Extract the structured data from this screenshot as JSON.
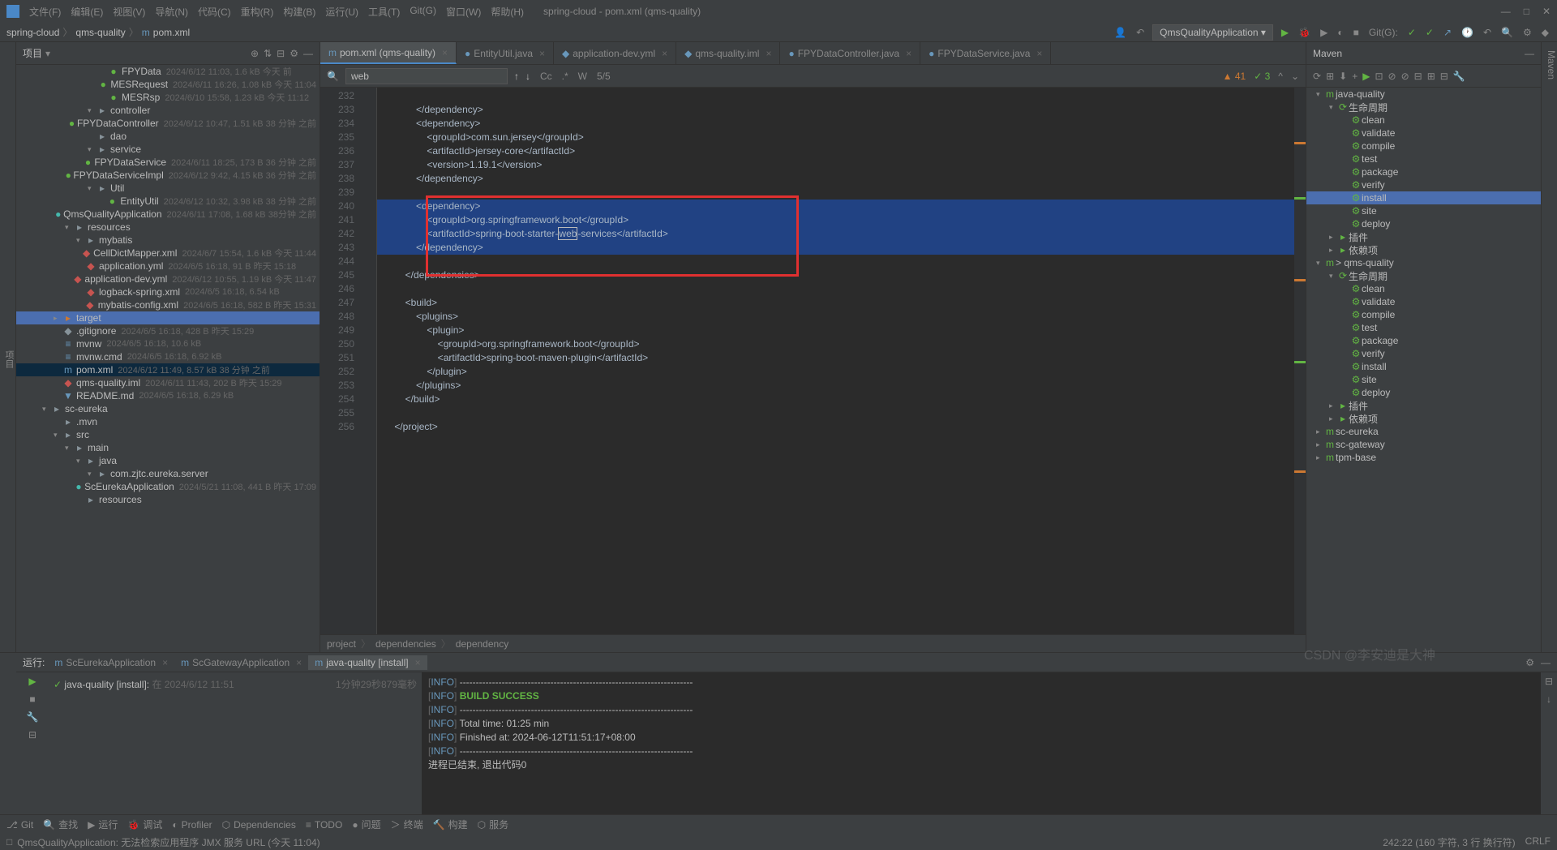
{
  "title": "spring-cloud - pom.xml (qms-quality)",
  "menus": [
    "文件(F)",
    "编辑(E)",
    "视图(V)",
    "导航(N)",
    "代码(C)",
    "重构(R)",
    "构建(B)",
    "运行(U)",
    "工具(T)",
    "Git(G)",
    "窗口(W)",
    "帮助(H)"
  ],
  "breadcrumb": {
    "p1": "spring-cloud",
    "p2": "qms-quality",
    "p3": "pom.xml",
    "icon": "m"
  },
  "topright": {
    "runconfig": "QmsQualityApplication",
    "git": "Git(G):"
  },
  "project": {
    "label": "项目"
  },
  "tree": [
    {
      "d": 7,
      "a": "",
      "i": "green",
      "ico": "●",
      "n": "FPYData",
      "m": "2024/6/12 11:03, 1.6 kB 今天 前"
    },
    {
      "d": 7,
      "a": "",
      "i": "green",
      "ico": "●",
      "n": "MESRequest",
      "m": "2024/6/11 16:26, 1.08 kB 今天 11:04"
    },
    {
      "d": 7,
      "a": "",
      "i": "green",
      "ico": "●",
      "n": "MESRsp",
      "m": "2024/6/10 15:58, 1.23 kB 今天 11:12"
    },
    {
      "d": 6,
      "a": "▾",
      "i": "folder",
      "ico": "▸",
      "n": "controller",
      "m": ""
    },
    {
      "d": 7,
      "a": "",
      "i": "green",
      "ico": "●",
      "n": "FPYDataController",
      "m": "2024/6/12 10:47, 1.51 kB 38 分钟 之前"
    },
    {
      "d": 6,
      "a": "",
      "i": "folder",
      "ico": "▸",
      "n": "dao",
      "m": ""
    },
    {
      "d": 6,
      "a": "▾",
      "i": "folder",
      "ico": "▸",
      "n": "service",
      "m": ""
    },
    {
      "d": 7,
      "a": "",
      "i": "green",
      "ico": "●",
      "n": "FPYDataService",
      "m": "2024/6/11 18:25, 173 B 36 分钟 之前"
    },
    {
      "d": 7,
      "a": "",
      "i": "green",
      "ico": "●",
      "n": "FPYDataServiceImpl",
      "m": "2024/6/12 9:42, 4.15 kB 36 分钟 之前"
    },
    {
      "d": 6,
      "a": "▾",
      "i": "folder",
      "ico": "▸",
      "n": "Util",
      "m": ""
    },
    {
      "d": 7,
      "a": "",
      "i": "green",
      "ico": "●",
      "n": "EntityUtil",
      "m": "2024/6/12 10:32, 3.98 kB 38 分钟 之前"
    },
    {
      "d": 5,
      "a": "",
      "i": "teal",
      "ico": "●",
      "n": "QmsQualityApplication",
      "m": "2024/6/11 17:08, 1.68 kB 38分钟 之前"
    },
    {
      "d": 4,
      "a": "▾",
      "i": "folder",
      "ico": "▸",
      "n": "resources",
      "m": ""
    },
    {
      "d": 5,
      "a": "▾",
      "i": "folder",
      "ico": "▸",
      "n": "mybatis",
      "m": ""
    },
    {
      "d": 6,
      "a": "",
      "i": "pink",
      "ico": "◆",
      "n": "CellDictMapper.xml",
      "m": "2024/6/7 15:54, 1.6 kB 今天 11:44"
    },
    {
      "d": 5,
      "a": "",
      "i": "pink",
      "ico": "◆",
      "n": "application.yml",
      "m": "2024/6/5 16:18, 91 B 昨天 15:18"
    },
    {
      "d": 5,
      "a": "",
      "i": "pink",
      "ico": "◆",
      "n": "application-dev.yml",
      "m": "2024/6/12 10:55, 1.19 kB 今天 11:47"
    },
    {
      "d": 5,
      "a": "",
      "i": "pink",
      "ico": "◆",
      "n": "logback-spring.xml",
      "m": "2024/6/5 16:18, 6.54 kB"
    },
    {
      "d": 5,
      "a": "",
      "i": "pink",
      "ico": "◆",
      "n": "mybatis-config.xml",
      "m": "2024/6/5 16:18, 582 B 昨天 15:31"
    },
    {
      "d": 3,
      "a": "▸",
      "i": "orange",
      "ico": "▸",
      "n": "target",
      "m": "",
      "sel": "hl"
    },
    {
      "d": 3,
      "a": "",
      "i": "folder",
      "ico": "◆",
      "n": ".gitignore",
      "m": "2024/6/5 16:18, 428 B 昨天 15:29"
    },
    {
      "d": 3,
      "a": "",
      "i": "blue",
      "ico": "≡",
      "n": "mvnw",
      "m": "2024/6/5 16:18, 10.6 kB"
    },
    {
      "d": 3,
      "a": "",
      "i": "blue",
      "ico": "≡",
      "n": "mvnw.cmd",
      "m": "2024/6/5 16:18, 6.92 kB"
    },
    {
      "d": 3,
      "a": "",
      "i": "blue",
      "ico": "m",
      "n": "pom.xml",
      "m": "2024/6/12 11:49, 8.57 kB 38 分钟 之前",
      "sel": "sel"
    },
    {
      "d": 3,
      "a": "",
      "i": "pink",
      "ico": "◆",
      "n": "qms-quality.iml",
      "m": "2024/6/11 11:43, 202 B 昨天 15:29"
    },
    {
      "d": 3,
      "a": "",
      "i": "blue",
      "ico": "▼",
      "n": "README.md",
      "m": "2024/6/5 16:18, 6.29 kB"
    },
    {
      "d": 2,
      "a": "▾",
      "i": "folder",
      "ico": "▸",
      "n": "sc-eureka",
      "m": ""
    },
    {
      "d": 3,
      "a": "",
      "i": "folder",
      "ico": "▸",
      "n": ".mvn",
      "m": ""
    },
    {
      "d": 3,
      "a": "▾",
      "i": "folder",
      "ico": "▸",
      "n": "src",
      "m": ""
    },
    {
      "d": 4,
      "a": "▾",
      "i": "folder",
      "ico": "▸",
      "n": "main",
      "m": ""
    },
    {
      "d": 5,
      "a": "▾",
      "i": "folder",
      "ico": "▸",
      "n": "java",
      "m": ""
    },
    {
      "d": 6,
      "a": "▾",
      "i": "folder",
      "ico": "▸",
      "n": "com.zjtc.eureka.server",
      "m": ""
    },
    {
      "d": 7,
      "a": "",
      "i": "teal",
      "ico": "●",
      "n": "ScEurekaApplication",
      "m": "2024/5/21 11:08, 441 B 昨天 17:09"
    },
    {
      "d": 5,
      "a": "",
      "i": "folder",
      "ico": "▸",
      "n": "resources",
      "m": ""
    }
  ],
  "tabs": [
    {
      "ico": "m",
      "label": "pom.xml (qms-quality)",
      "active": true
    },
    {
      "ico": "●",
      "label": "EntityUtil.java"
    },
    {
      "ico": "◆",
      "label": "application-dev.yml"
    },
    {
      "ico": "◆",
      "label": "qms-quality.iml"
    },
    {
      "ico": "●",
      "label": "FPYDataController.java"
    },
    {
      "ico": "●",
      "label": "FPYDataService.java"
    }
  ],
  "find": {
    "query": "web",
    "count": "5/5",
    "opts": [
      "Cc",
      ".*",
      "W"
    ]
  },
  "findright": {
    "warn": "▲ 41",
    "ok": "✓ 3"
  },
  "gutter_start": 232,
  "gutter_count": 25,
  "code": [
    {
      "t": ""
    },
    {
      "t": "            </dependency>"
    },
    {
      "t": "            <dependency>"
    },
    {
      "t": "                <groupId>com.sun.jersey</groupId>"
    },
    {
      "t": "                <artifactId>jersey-core</artifactId>"
    },
    {
      "t": "                <version>1.19.1</version>"
    },
    {
      "t": "            </dependency>"
    },
    {
      "t": ""
    },
    {
      "t": "            <dependency>",
      "sel": true
    },
    {
      "t": "                <groupId>org.springframework.boot</groupId>",
      "sel": true
    },
    {
      "t": "                <artifactId>spring-boot-starter-web-services</artifactId>",
      "sel": true,
      "hl": "web"
    },
    {
      "t": "            </dependency>",
      "sel": true
    },
    {
      "t": ""
    },
    {
      "t": "        </dependencies>"
    },
    {
      "t": ""
    },
    {
      "t": "        <build>"
    },
    {
      "t": "            <plugins>"
    },
    {
      "t": "                <plugin>"
    },
    {
      "t": "                    <groupId>org.springframework.boot</groupId>"
    },
    {
      "t": "                    <artifactId>spring-boot-maven-plugin</artifactId>"
    },
    {
      "t": "                </plugin>"
    },
    {
      "t": "            </plugins>"
    },
    {
      "t": "        </build>"
    },
    {
      "t": ""
    },
    {
      "t": "    </project>"
    },
    {
      "t": ""
    }
  ],
  "breadcrumb2": [
    "project",
    "dependencies",
    "dependency"
  ],
  "maven": {
    "label": "Maven"
  },
  "maven_tree": [
    {
      "d": 0,
      "a": "▾",
      "i": "m",
      "n": "java-quality"
    },
    {
      "d": 1,
      "a": "▾",
      "i": "⟳",
      "n": "生命周期"
    },
    {
      "d": 2,
      "a": "",
      "i": "⚙",
      "n": "clean"
    },
    {
      "d": 2,
      "a": "",
      "i": "⚙",
      "n": "validate"
    },
    {
      "d": 2,
      "a": "",
      "i": "⚙",
      "n": "compile"
    },
    {
      "d": 2,
      "a": "",
      "i": "⚙",
      "n": "test"
    },
    {
      "d": 2,
      "a": "",
      "i": "⚙",
      "n": "package"
    },
    {
      "d": 2,
      "a": "",
      "i": "⚙",
      "n": "verify"
    },
    {
      "d": 2,
      "a": "",
      "i": "⚙",
      "n": "install",
      "sel": true
    },
    {
      "d": 2,
      "a": "",
      "i": "⚙",
      "n": "site"
    },
    {
      "d": 2,
      "a": "",
      "i": "⚙",
      "n": "deploy"
    },
    {
      "d": 1,
      "a": "▸",
      "i": "▸",
      "n": "插件"
    },
    {
      "d": 1,
      "a": "▸",
      "i": "▸",
      "n": "依赖项"
    },
    {
      "d": 0,
      "a": "▾",
      "i": "m",
      "n": "> qms-quality"
    },
    {
      "d": 1,
      "a": "▾",
      "i": "⟳",
      "n": "生命周期"
    },
    {
      "d": 2,
      "a": "",
      "i": "⚙",
      "n": "clean"
    },
    {
      "d": 2,
      "a": "",
      "i": "⚙",
      "n": "validate"
    },
    {
      "d": 2,
      "a": "",
      "i": "⚙",
      "n": "compile"
    },
    {
      "d": 2,
      "a": "",
      "i": "⚙",
      "n": "test"
    },
    {
      "d": 2,
      "a": "",
      "i": "⚙",
      "n": "package"
    },
    {
      "d": 2,
      "a": "",
      "i": "⚙",
      "n": "verify"
    },
    {
      "d": 2,
      "a": "",
      "i": "⚙",
      "n": "install"
    },
    {
      "d": 2,
      "a": "",
      "i": "⚙",
      "n": "site"
    },
    {
      "d": 2,
      "a": "",
      "i": "⚙",
      "n": "deploy"
    },
    {
      "d": 1,
      "a": "▸",
      "i": "▸",
      "n": "插件"
    },
    {
      "d": 1,
      "a": "▸",
      "i": "▸",
      "n": "依赖项"
    },
    {
      "d": 0,
      "a": "▸",
      "i": "m",
      "n": "sc-eureka"
    },
    {
      "d": 0,
      "a": "▸",
      "i": "m",
      "n": "sc-gateway"
    },
    {
      "d": 0,
      "a": "▸",
      "i": "m",
      "n": "tpm-base"
    }
  ],
  "run": {
    "label": "运行:",
    "tabs": [
      {
        "l": "ScEurekaApplication"
      },
      {
        "l": "ScGatewayApplication"
      },
      {
        "l": "java-quality [install]",
        "active": true
      }
    ],
    "task": "java-quality [install]:",
    "taskmeta": "在 2024/6/12 11:51",
    "elapsed": "1分钟29秒879毫秒"
  },
  "console": [
    {
      "p": "[",
      "i": "INFO",
      "s": "] ------------------------------------------------------------------------"
    },
    {
      "p": "[",
      "i": "INFO",
      "s": "] ",
      "succ": "BUILD SUCCESS"
    },
    {
      "p": "[",
      "i": "INFO",
      "s": "] ------------------------------------------------------------------------"
    },
    {
      "p": "[",
      "i": "INFO",
      "s": "] Total time:  01:25 min"
    },
    {
      "p": "[",
      "i": "INFO",
      "s": "] Finished at: 2024-06-12T11:51:17+08:00"
    },
    {
      "p": "[",
      "i": "INFO",
      "s": "] ------------------------------------------------------------------------"
    },
    {
      "p": "",
      "i": "",
      "s": ""
    },
    {
      "p": "",
      "i": "",
      "s": "进程已结束, 退出代码0"
    }
  ],
  "bottombar": [
    {
      "i": "⎇",
      "l": "Git"
    },
    {
      "i": "🔍",
      "l": "查找"
    },
    {
      "i": "▶",
      "l": "运行"
    },
    {
      "i": "🐞",
      "l": "调试"
    },
    {
      "i": "◐",
      "l": "Profiler"
    },
    {
      "i": "⬡",
      "l": "Dependencies"
    },
    {
      "i": "≡",
      "l": "TODO"
    },
    {
      "i": "●",
      "l": "问题"
    },
    {
      "i": "＞",
      "l": "终端"
    },
    {
      "i": "🔨",
      "l": "构建"
    },
    {
      "i": "⬡",
      "l": "服务"
    }
  ],
  "status": {
    "msg": "QmsQualityApplication: 无法检索应用程序 JMX 服务 URL (今天 11:04)",
    "pos": "242:22 (160 字符, 3 行 换行符)",
    "enc": "CRLF"
  },
  "watermark": "CSDN @李安迪是大神"
}
